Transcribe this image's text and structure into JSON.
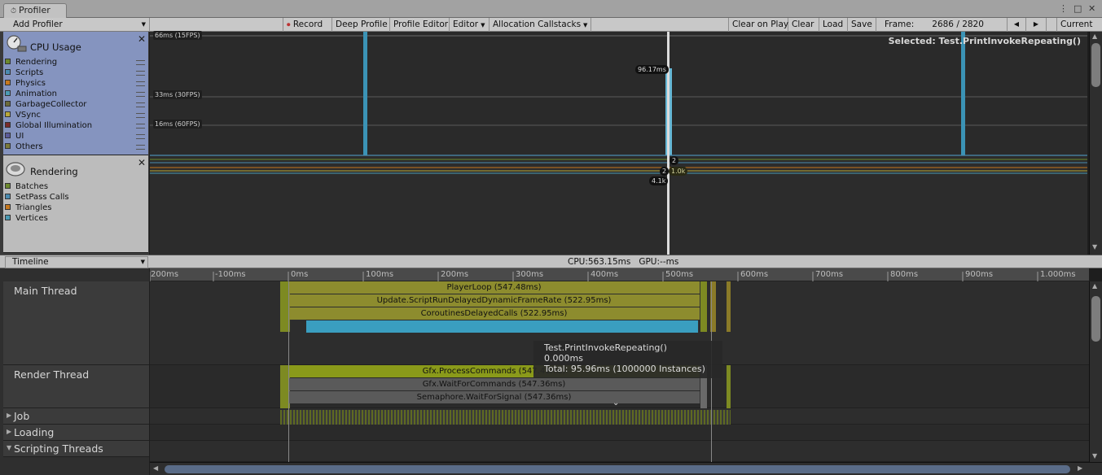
{
  "window": {
    "title": "Profiler",
    "controls": [
      "⋮",
      "□",
      "✕"
    ]
  },
  "toolbar": {
    "add_profiler": "Add Profiler",
    "record": "Record",
    "deep_profile": "Deep Profile",
    "profile_editor": "Profile Editor",
    "editor": "Editor",
    "allocation_callstacks": "Allocation Callstacks",
    "clear_on_play": "Clear on Play",
    "clear": "Clear",
    "load": "Load",
    "save": "Save",
    "frame_label": "Frame:",
    "frame_value": "2686 / 2820",
    "current": "Current"
  },
  "modules": {
    "cpu": {
      "title": "CPU Usage",
      "items": [
        {
          "label": "Rendering",
          "color": "#6c8a2e"
        },
        {
          "label": "Scripts",
          "color": "#4a8bb0"
        },
        {
          "label": "Physics",
          "color": "#c6781e"
        },
        {
          "label": "Animation",
          "color": "#4a9bb5"
        },
        {
          "label": "GarbageCollector",
          "color": "#6b6b3a"
        },
        {
          "label": "VSync",
          "color": "#b8a83a"
        },
        {
          "label": "Global Illumination",
          "color": "#7a2a2a"
        },
        {
          "label": "UI",
          "color": "#5a5a9a"
        },
        {
          "label": "Others",
          "color": "#7a7a3a"
        }
      ]
    },
    "rendering": {
      "title": "Rendering",
      "items": [
        {
          "label": "Batches",
          "color": "#6c8a2e"
        },
        {
          "label": "SetPass Calls",
          "color": "#4a8bb0"
        },
        {
          "label": "Triangles",
          "color": "#c6781e"
        },
        {
          "label": "Vertices",
          "color": "#4a9bb5"
        }
      ]
    }
  },
  "graph": {
    "lines": [
      "66ms (15FPS)",
      "33ms (30FPS)",
      "16ms (60FPS)"
    ],
    "selected": "Selected: Test.PrintInvokeRepeating()",
    "badges": {
      "frame_ms": "96.17ms",
      "a": "2",
      "b": "2",
      "c": "1.0k",
      "d": "4.1k"
    }
  },
  "timeline": {
    "mode": "Timeline",
    "cpu": "CPU:563.15ms",
    "gpu": "GPU:--ms",
    "ticks": [
      "200ms",
      "-100ms",
      "0ms",
      "100ms",
      "200ms",
      "300ms",
      "400ms",
      "500ms",
      "600ms",
      "700ms",
      "800ms",
      "900ms",
      "1.000ms"
    ]
  },
  "threads": {
    "main": "Main Thread",
    "render": "Render Thread",
    "job": "Job",
    "loading": "Loading",
    "scripting": "Scripting Threads"
  },
  "samples": {
    "player_loop": "PlayerLoop (547.48ms)",
    "update_script": "Update.ScriptRunDelayedDynamicFrameRate (522.95ms)",
    "coroutines": "CoroutinesDelayedCalls (522.95ms)",
    "gfx_process": "Gfx.ProcessCommands (547.41ms)",
    "gfx_wait": "Gfx.WaitForCommands (547.36ms)",
    "semaphore": "Semaphore.WaitForSignal (547.36ms)"
  },
  "tooltip": {
    "name": "Test.PrintInvokeRepeating()",
    "self": "0.000ms",
    "total": "Total: 95.96ms (1000000 Instances)"
  }
}
